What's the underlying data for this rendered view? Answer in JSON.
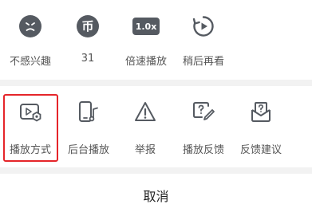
{
  "row1": {
    "items": [
      {
        "label": "不感兴趣",
        "icon": "not-interested-icon"
      },
      {
        "label": "31",
        "icon": "coin-icon",
        "icon_glyph": "币"
      },
      {
        "label": "倍速播放",
        "icon": "speed-icon",
        "icon_text": "1.0x"
      },
      {
        "label": "稍后再看",
        "icon": "watch-later-icon"
      }
    ]
  },
  "row2": {
    "items": [
      {
        "label": "播放方式",
        "icon": "play-mode-icon"
      },
      {
        "label": "后台播放",
        "icon": "background-play-icon"
      },
      {
        "label": "举报",
        "icon": "report-icon"
      },
      {
        "label": "播放反馈",
        "icon": "playback-feedback-icon"
      },
      {
        "label": "反馈建议",
        "icon": "feedback-suggestion-icon"
      }
    ]
  },
  "cancel_label": "取消",
  "colors": {
    "icon": "#555a61",
    "label": "#555555",
    "highlight": "#e5252a",
    "divider": "#f2f2f2"
  }
}
